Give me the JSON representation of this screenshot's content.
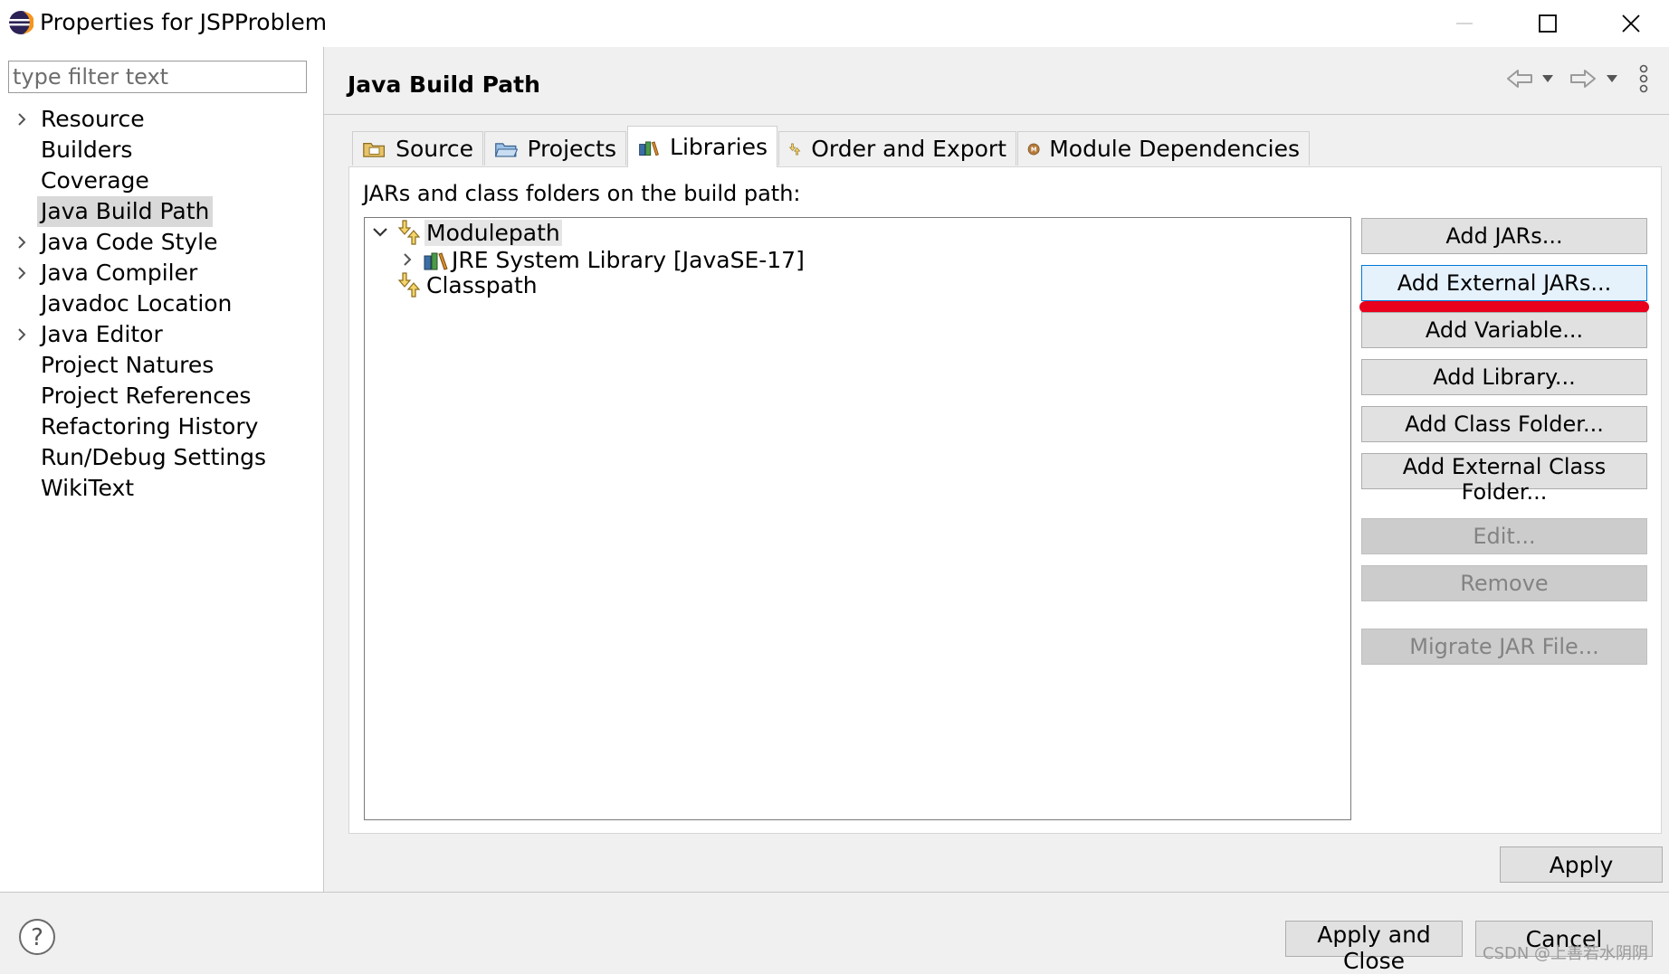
{
  "window": {
    "title": "Properties for JSPProblem",
    "minimize_icon": "minimize-icon",
    "maximize_icon": "maximize-icon",
    "close_icon": "close-icon"
  },
  "filter": {
    "placeholder": "type filter text",
    "value": ""
  },
  "nav": {
    "selected": "Java Build Path",
    "items": [
      {
        "label": "Resource",
        "expandable": true
      },
      {
        "label": "Builders",
        "expandable": false
      },
      {
        "label": "Coverage",
        "expandable": false
      },
      {
        "label": "Java Build Path",
        "expandable": false
      },
      {
        "label": "Java Code Style",
        "expandable": true
      },
      {
        "label": "Java Compiler",
        "expandable": true
      },
      {
        "label": "Javadoc Location",
        "expandable": false
      },
      {
        "label": "Java Editor",
        "expandable": true
      },
      {
        "label": "Project Natures",
        "expandable": false
      },
      {
        "label": "Project References",
        "expandable": false
      },
      {
        "label": "Refactoring History",
        "expandable": false
      },
      {
        "label": "Run/Debug Settings",
        "expandable": false
      },
      {
        "label": "WikiText",
        "expandable": false
      }
    ]
  },
  "header": {
    "title": "Java Build Path",
    "icons": [
      "back-arrow-icon",
      "back-dropdown-icon",
      "forward-arrow-icon",
      "forward-dropdown-icon",
      "view-menu-icon"
    ]
  },
  "tabs": [
    {
      "label": "Source",
      "icon": "source-folder-icon",
      "active": false
    },
    {
      "label": "Projects",
      "icon": "projects-folder-icon",
      "active": false
    },
    {
      "label": "Libraries",
      "icon": "libraries-icon",
      "active": true
    },
    {
      "label": "Order and Export",
      "icon": "order-export-icon",
      "active": false
    },
    {
      "label": "Module Dependencies",
      "icon": "module-icon",
      "active": false
    }
  ],
  "libraries": {
    "section_label": "JARs and class folders on the build path:",
    "tree": {
      "modulepath": {
        "label": "Modulepath",
        "expanded": true,
        "selected": true
      },
      "jre": {
        "label": "JRE System Library [JavaSE-17]",
        "expanded": false
      },
      "classpath": {
        "label": "Classpath"
      }
    },
    "buttons": {
      "add_jars": "Add JARs...",
      "add_external_jars": "Add External JARs...",
      "add_variable": "Add Variable...",
      "add_library": "Add Library...",
      "add_class_folder": "Add Class Folder...",
      "add_external_class_folder": "Add External Class Folder...",
      "edit": "Edit...",
      "remove": "Remove",
      "migrate_jar": "Migrate JAR File..."
    },
    "annotation_color": "#e8001c"
  },
  "footer": {
    "apply": "Apply",
    "apply_and_close": "Apply and Close",
    "cancel": "Cancel",
    "help_icon": "help-icon",
    "watermark": "CSDN @上善若水阴阴"
  },
  "colors": {
    "window_bg": "#f0f0f0",
    "panel_bg": "#ffffff",
    "selection_bg": "#d9d9d9",
    "focus_border": "#0078d7",
    "disabled_text": "#838383"
  }
}
